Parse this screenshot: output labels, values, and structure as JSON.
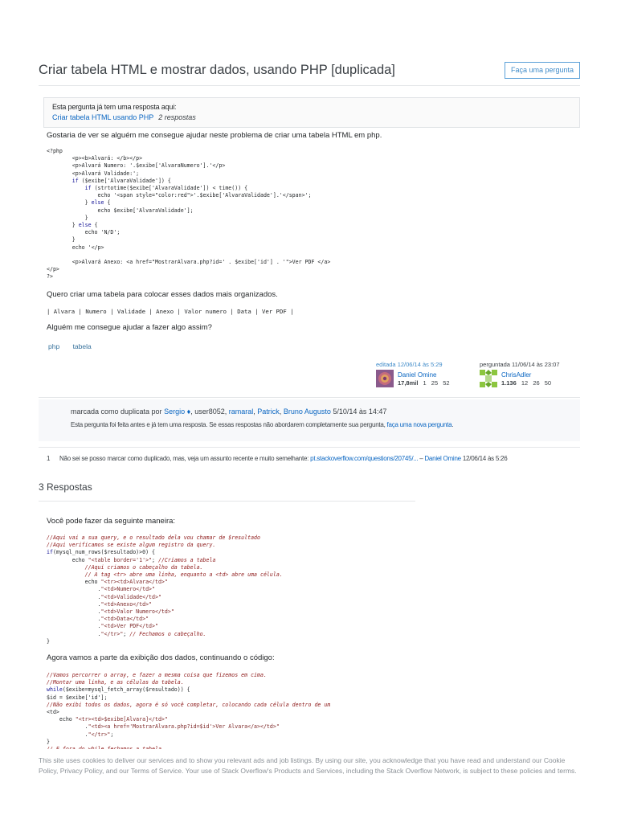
{
  "question": {
    "title": "Criar tabela HTML e mostrar dados, usando PHP [duplicada]",
    "ask_button": "Faça uma pergunta",
    "duplicate_notice": {
      "text": "Esta pergunta já tem uma resposta aqui:",
      "link": "Criar tabela HTML usando PHP",
      "count": "2 respostas"
    },
    "body_intro": "Gostaria de ver se alguém me consegue ajudar neste problema de criar uma tabela HTML em php.",
    "body_middle": "Quero criar uma tabela para colocar esses dados mais organizados.",
    "table_line": "| Alvara | Numero | Validade | Anexo | Valor numero | Data | Ver PDF |",
    "body_end": "Alguém me consegue ajudar a fazer algo assim?",
    "tags": [
      "php",
      "tabela"
    ],
    "edited": {
      "action": "editada 12/06/14 às 5:29",
      "user": "Daniel Omine",
      "rep": "17,8mil",
      "gold": "1",
      "silver": "25",
      "bronze": "52"
    },
    "asked": {
      "action": "perguntada 11/06/14 às 23:07",
      "user": "ChrisAdler",
      "rep": "1.136",
      "gold": "12",
      "silver": "26",
      "bronze": "50"
    }
  },
  "closed": {
    "prefix": "marcada como duplicata por",
    "users": [
      "Sergio ♦",
      "user8052",
      "ramaral",
      "Patrick",
      "Bruno Augusto"
    ],
    "date": "5/10/14 às 14:47",
    "message": "Esta pergunta foi feita antes e já tem uma resposta. Se essas respostas não abordarem completamente sua pergunta,",
    "message_link": "faça uma nova pergunta"
  },
  "comment": {
    "score": "1",
    "text": "Não sei se posso marcar como duplicado, mas, veja um assunto recente e muito semelhante:",
    "link": "pt.stackoverflow.com/questions/20745/...",
    "dash": "–",
    "author": "Daniel Omine",
    "date": "12/06/14 às 5:26"
  },
  "answers": {
    "heading": "3 Respostas",
    "intro": "Você pode fazer da seguinte maneira:",
    "middle": "Agora vamos a parte da exibição dos dados, continuando o código:"
  },
  "cookie_banner": "This site uses cookies to deliver our services and to show you relevant ads and job listings. By using our site, you acknowledge that you have read and understand our Cookie Policy, Privacy Policy, and our Terms of Service. Your use of Stack Overflow's Products and Services, including the Stack Overflow Network, is subject to these policies and terms.",
  "colors": {
    "link": "#0a66c2",
    "tag": "#39739d",
    "border": "#e4e6e8",
    "code_comment": "#8e1a1a"
  }
}
